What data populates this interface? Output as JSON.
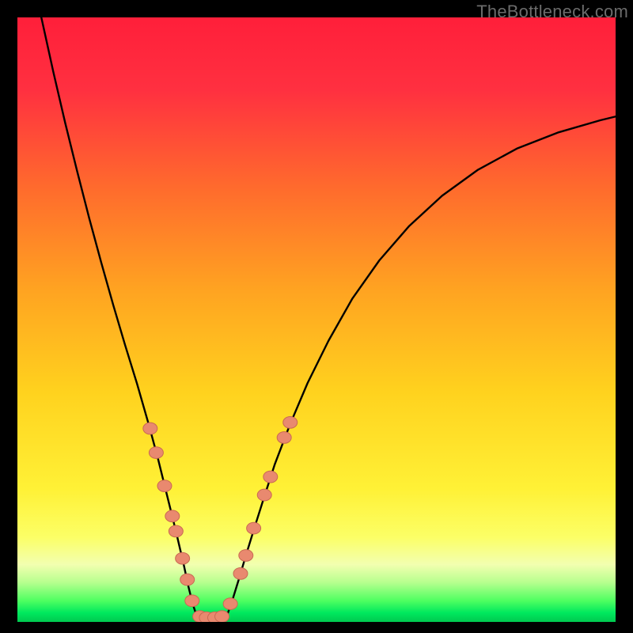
{
  "watermark": "TheBottleneck.com",
  "colors": {
    "gradient_stops": [
      {
        "offset": 0.0,
        "color": "#ff1f3a"
      },
      {
        "offset": 0.12,
        "color": "#ff3040"
      },
      {
        "offset": 0.28,
        "color": "#ff6a2d"
      },
      {
        "offset": 0.45,
        "color": "#ffa321"
      },
      {
        "offset": 0.62,
        "color": "#ffd21e"
      },
      {
        "offset": 0.78,
        "color": "#fff136"
      },
      {
        "offset": 0.86,
        "color": "#fcff66"
      },
      {
        "offset": 0.905,
        "color": "#f2ffb0"
      },
      {
        "offset": 0.935,
        "color": "#b6ff8e"
      },
      {
        "offset": 0.965,
        "color": "#4eff60"
      },
      {
        "offset": 0.985,
        "color": "#00e85e"
      },
      {
        "offset": 1.0,
        "color": "#00c94f"
      }
    ],
    "curve": "#000000",
    "marker_fill": "#e9896f",
    "marker_stroke": "#c96a52",
    "frame": "#000000"
  },
  "chart_data": {
    "type": "line",
    "title": "",
    "xlabel": "",
    "ylabel": "",
    "xlim": [
      0,
      100
    ],
    "ylim": [
      0,
      100
    ],
    "grid": false,
    "legend": false,
    "series": [
      {
        "name": "left-branch",
        "x": [
          4.0,
          6.0,
          8.0,
          10.0,
          12.0,
          14.0,
          16.0,
          18.0,
          20.0,
          22.0,
          23.5,
          25.0,
          26.5,
          27.8,
          28.6,
          29.3,
          29.9,
          30.5
        ],
        "y": [
          100.0,
          91.0,
          82.5,
          74.5,
          66.8,
          59.5,
          52.5,
          45.8,
          39.4,
          32.5,
          27.0,
          21.0,
          15.0,
          9.5,
          5.8,
          3.0,
          1.2,
          0.0
        ]
      },
      {
        "name": "valley-floor",
        "x": [
          30.5,
          31.5,
          32.5,
          33.5,
          34.5
        ],
        "y": [
          0.0,
          0.0,
          0.0,
          0.0,
          0.0
        ]
      },
      {
        "name": "right-branch",
        "x": [
          34.5,
          35.2,
          36.0,
          37.0,
          38.2,
          39.6,
          41.2,
          43.0,
          45.5,
          48.5,
          52.0,
          56.0,
          60.5,
          65.5,
          71.0,
          77.0,
          83.5,
          90.5,
          97.5,
          100.0
        ],
        "y": [
          0.0,
          1.5,
          3.8,
          7.0,
          11.0,
          15.5,
          20.5,
          26.0,
          32.5,
          39.5,
          46.5,
          53.5,
          59.8,
          65.5,
          70.5,
          74.8,
          78.3,
          81.0,
          83.0,
          83.6
        ]
      }
    ],
    "markers": {
      "name": "highlight-points",
      "points": [
        {
          "x": 22.2,
          "y": 32.0
        },
        {
          "x": 23.2,
          "y": 28.0
        },
        {
          "x": 24.6,
          "y": 22.5
        },
        {
          "x": 25.9,
          "y": 17.5
        },
        {
          "x": 26.5,
          "y": 15.0
        },
        {
          "x": 27.6,
          "y": 10.5
        },
        {
          "x": 28.4,
          "y": 7.0
        },
        {
          "x": 29.2,
          "y": 3.5
        },
        {
          "x": 30.5,
          "y": 0.9
        },
        {
          "x": 31.6,
          "y": 0.7
        },
        {
          "x": 33.0,
          "y": 0.7
        },
        {
          "x": 34.2,
          "y": 0.9
        },
        {
          "x": 35.6,
          "y": 3.0
        },
        {
          "x": 37.3,
          "y": 8.0
        },
        {
          "x": 38.2,
          "y": 11.0
        },
        {
          "x": 39.5,
          "y": 15.5
        },
        {
          "x": 41.3,
          "y": 21.0
        },
        {
          "x": 42.3,
          "y": 24.0
        },
        {
          "x": 44.6,
          "y": 30.5
        },
        {
          "x": 45.6,
          "y": 33.0
        }
      ],
      "radius": 9
    }
  }
}
